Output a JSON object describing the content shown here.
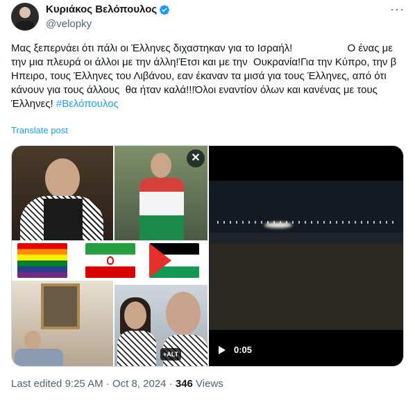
{
  "author": {
    "name": "Κυριάκος Βελόπουλος",
    "handle": "@velopky",
    "verified_color": "#1d9bf0"
  },
  "post": {
    "text": "Μας ξεπερνάει ότι πάλι οι Έλληνες διχαστηκαν για το Ισραήλ!                   Ο ένας με την μια πλευρά οι άλλοι με την άλλη!Έτσι και με την  Ουκρανία!Για την Κύπρο, την β Ηπειρο, τους Έλληνες του Λιβάνου, εαν έκαναν τα μισά για τους Έλληνες, από ότι κάνουν για τους άλλους  θα ήταν καλά!!!Όλοι εναντίον όλων και κανένας με τους  Έλληνες! ",
    "hashtag": "#Βελόπουλος",
    "translate_label": "Translate post"
  },
  "media": {
    "close_label": "✕",
    "alt_label": "+ALT",
    "video_duration": "0:05"
  },
  "meta": {
    "edited_prefix": "Last edited ",
    "time": "9:25 AM",
    "separator": " · ",
    "date": "Oct 8, 2024",
    "views_count": "346",
    "views_label": " Views"
  },
  "colors": {
    "link": "#1d9bf0",
    "secondary_text": "#536471",
    "primary_text": "#0f1419"
  },
  "icons": [
    "verified-badge-icon",
    "more-options-icon",
    "close-icon",
    "play-icon"
  ]
}
